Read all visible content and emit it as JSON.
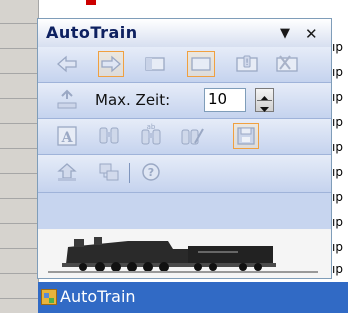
{
  "toolbar": {
    "title": "AutoTrain",
    "dropdown_glyph": "▼",
    "close_glyph": "✕",
    "max_zeit_label": "Max. Zeit:",
    "max_zeit_value": "10"
  },
  "selection": {
    "label": "AutoTrain"
  },
  "background": {
    "line_fragment": "ıp"
  },
  "icons": [
    "arrow-left-icon",
    "arrow-right-icon",
    "window-icon",
    "window-icon",
    "info-window-icon",
    "delete-window-icon",
    "weight-icon",
    "spinner-icon",
    "text-a-icon",
    "binoculars-icon",
    "binoculars-icon",
    "binoculars-edit-icon",
    "save-icon",
    "upload-icon",
    "network-icon",
    "help-icon",
    "train-image",
    "autotrain-icon"
  ],
  "colors": {
    "panel": "#c7d5ef",
    "selection": "#316ac5",
    "highlight_border": "#f0a040",
    "title_text": "#0e2160"
  }
}
